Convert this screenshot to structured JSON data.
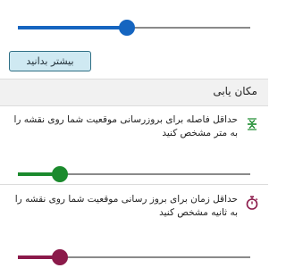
{
  "colors": {
    "accent_blue": "#1565c0",
    "accent_green": "#1b8a2d",
    "accent_maroon": "#8b1a4a",
    "track_rest": "#8a8a8a"
  },
  "top_slider": {
    "value_fraction": 0.47
  },
  "learn_more_button": {
    "label": "بیشتر بدانید"
  },
  "location_section": {
    "title": "مکان یابی",
    "distance_setting": {
      "icon": "distance-arrows-icon",
      "description": "حداقل فاصله برای بروزرسانی موقعیت شما روی نقشه را به متر مشخص کنید",
      "slider_value_fraction": 0.18
    },
    "time_setting": {
      "icon": "stopwatch-icon",
      "description": "حداقل زمان برای بروز رسانی موقعیت شما روی نقشه را به ثانیه مشخص کنید",
      "slider_value_fraction": 0.18
    }
  }
}
